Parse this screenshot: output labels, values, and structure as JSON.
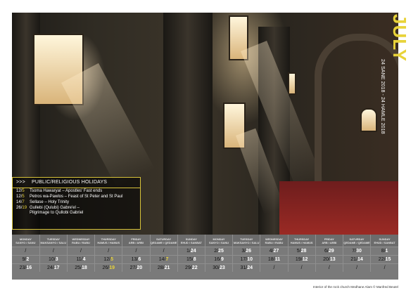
{
  "month": {
    "name": "JULY",
    "subtitle": "24 SANE 2018 - 24 HAMLE 2018"
  },
  "holidays": {
    "arrows": ">>>",
    "title": "PUBLIC/RELIGIOUS HOLIDAYS",
    "items": [
      {
        "greg": "12",
        "eth": "5",
        "text": "Tsoma Hawaryat – Apostles' Fast ends"
      },
      {
        "greg": "12",
        "eth": "5",
        "text": "Petros wa-Pawlos – Feast of St Peter and St Paul"
      },
      {
        "greg": "14",
        "eth": "7",
        "text": "Sellase – Holy Trinity"
      },
      {
        "greg": "26",
        "eth": "19",
        "text": "Gullebi (Qulubi) Gabre'el –",
        "text2": "Pilgrimage to Qullobi Gabriel"
      }
    ]
  },
  "calendar": {
    "headers": [
      {
        "en": "MONDAY",
        "am": "SANYO / SANU"
      },
      {
        "en": "TUESDAY",
        "am": "MAKSANYO / SALU"
      },
      {
        "en": "WEDNESDAY",
        "am": "RABU / RABU"
      },
      {
        "en": "THURSDAY",
        "am": "HAMUS / HAMUS"
      },
      {
        "en": "FRIDAY",
        "am": "ARB / ARBI"
      },
      {
        "en": "SATURDAY",
        "am": "QEDAME / QEDAME"
      },
      {
        "en": "SUNDAY",
        "am": "EHUD / SANBAT"
      },
      {
        "en": "MONDAY",
        "am": "SANYO / SANU"
      },
      {
        "en": "TUESDAY",
        "am": "MAKSANYO / SALU"
      },
      {
        "en": "WEDNESDAY",
        "am": "RABU / RABU"
      },
      {
        "en": "THURSDAY",
        "am": "HAMUS / HAMUS"
      },
      {
        "en": "FRIDAY",
        "am": "ARB / ARBI"
      },
      {
        "en": "SATURDAY",
        "am": "QEDAME / QEDAME"
      },
      {
        "en": "SUNDAY",
        "am": "EHUD / SANBAT"
      }
    ],
    "rows": [
      [
        {
          "g": "",
          "e": ""
        },
        {
          "g": "",
          "e": ""
        },
        {
          "g": "",
          "e": ""
        },
        {
          "g": "",
          "e": ""
        },
        {
          "g": "",
          "e": ""
        },
        {
          "g": "",
          "e": ""
        },
        {
          "g": "1",
          "e": "24"
        },
        {
          "g": "2",
          "e": "25"
        },
        {
          "g": "3",
          "e": "26"
        },
        {
          "g": "4",
          "e": "27"
        },
        {
          "g": "5",
          "e": "28"
        },
        {
          "g": "6",
          "e": "29"
        },
        {
          "g": "7",
          "e": "30"
        },
        {
          "g": "8",
          "e": "1"
        }
      ],
      [
        {
          "g": "9",
          "e": "2"
        },
        {
          "g": "10",
          "e": "3"
        },
        {
          "g": "11",
          "e": "4"
        },
        {
          "g": "12",
          "e": "5",
          "hl": true
        },
        {
          "g": "13",
          "e": "6"
        },
        {
          "g": "14",
          "e": "7",
          "hl": true
        },
        {
          "g": "15",
          "e": "8"
        },
        {
          "g": "16",
          "e": "9"
        },
        {
          "g": "17",
          "e": "10"
        },
        {
          "g": "18",
          "e": "11"
        },
        {
          "g": "19",
          "e": "12"
        },
        {
          "g": "20",
          "e": "13"
        },
        {
          "g": "21",
          "e": "14"
        },
        {
          "g": "22",
          "e": "15"
        }
      ],
      [
        {
          "g": "23",
          "e": "16"
        },
        {
          "g": "24",
          "e": "17"
        },
        {
          "g": "25",
          "e": "18"
        },
        {
          "g": "26",
          "e": "19",
          "hl": true
        },
        {
          "g": "27",
          "e": "20"
        },
        {
          "g": "28",
          "e": "21"
        },
        {
          "g": "29",
          "e": "22"
        },
        {
          "g": "30",
          "e": "23"
        },
        {
          "g": "31",
          "e": "24"
        },
        {
          "g": "",
          "e": ""
        },
        {
          "g": "",
          "e": ""
        },
        {
          "g": "",
          "e": ""
        },
        {
          "g": "",
          "e": ""
        },
        {
          "g": "",
          "e": ""
        }
      ]
    ]
  },
  "caption": "Interior of the rock church Medhane Alam  © Manfred Beutel"
}
